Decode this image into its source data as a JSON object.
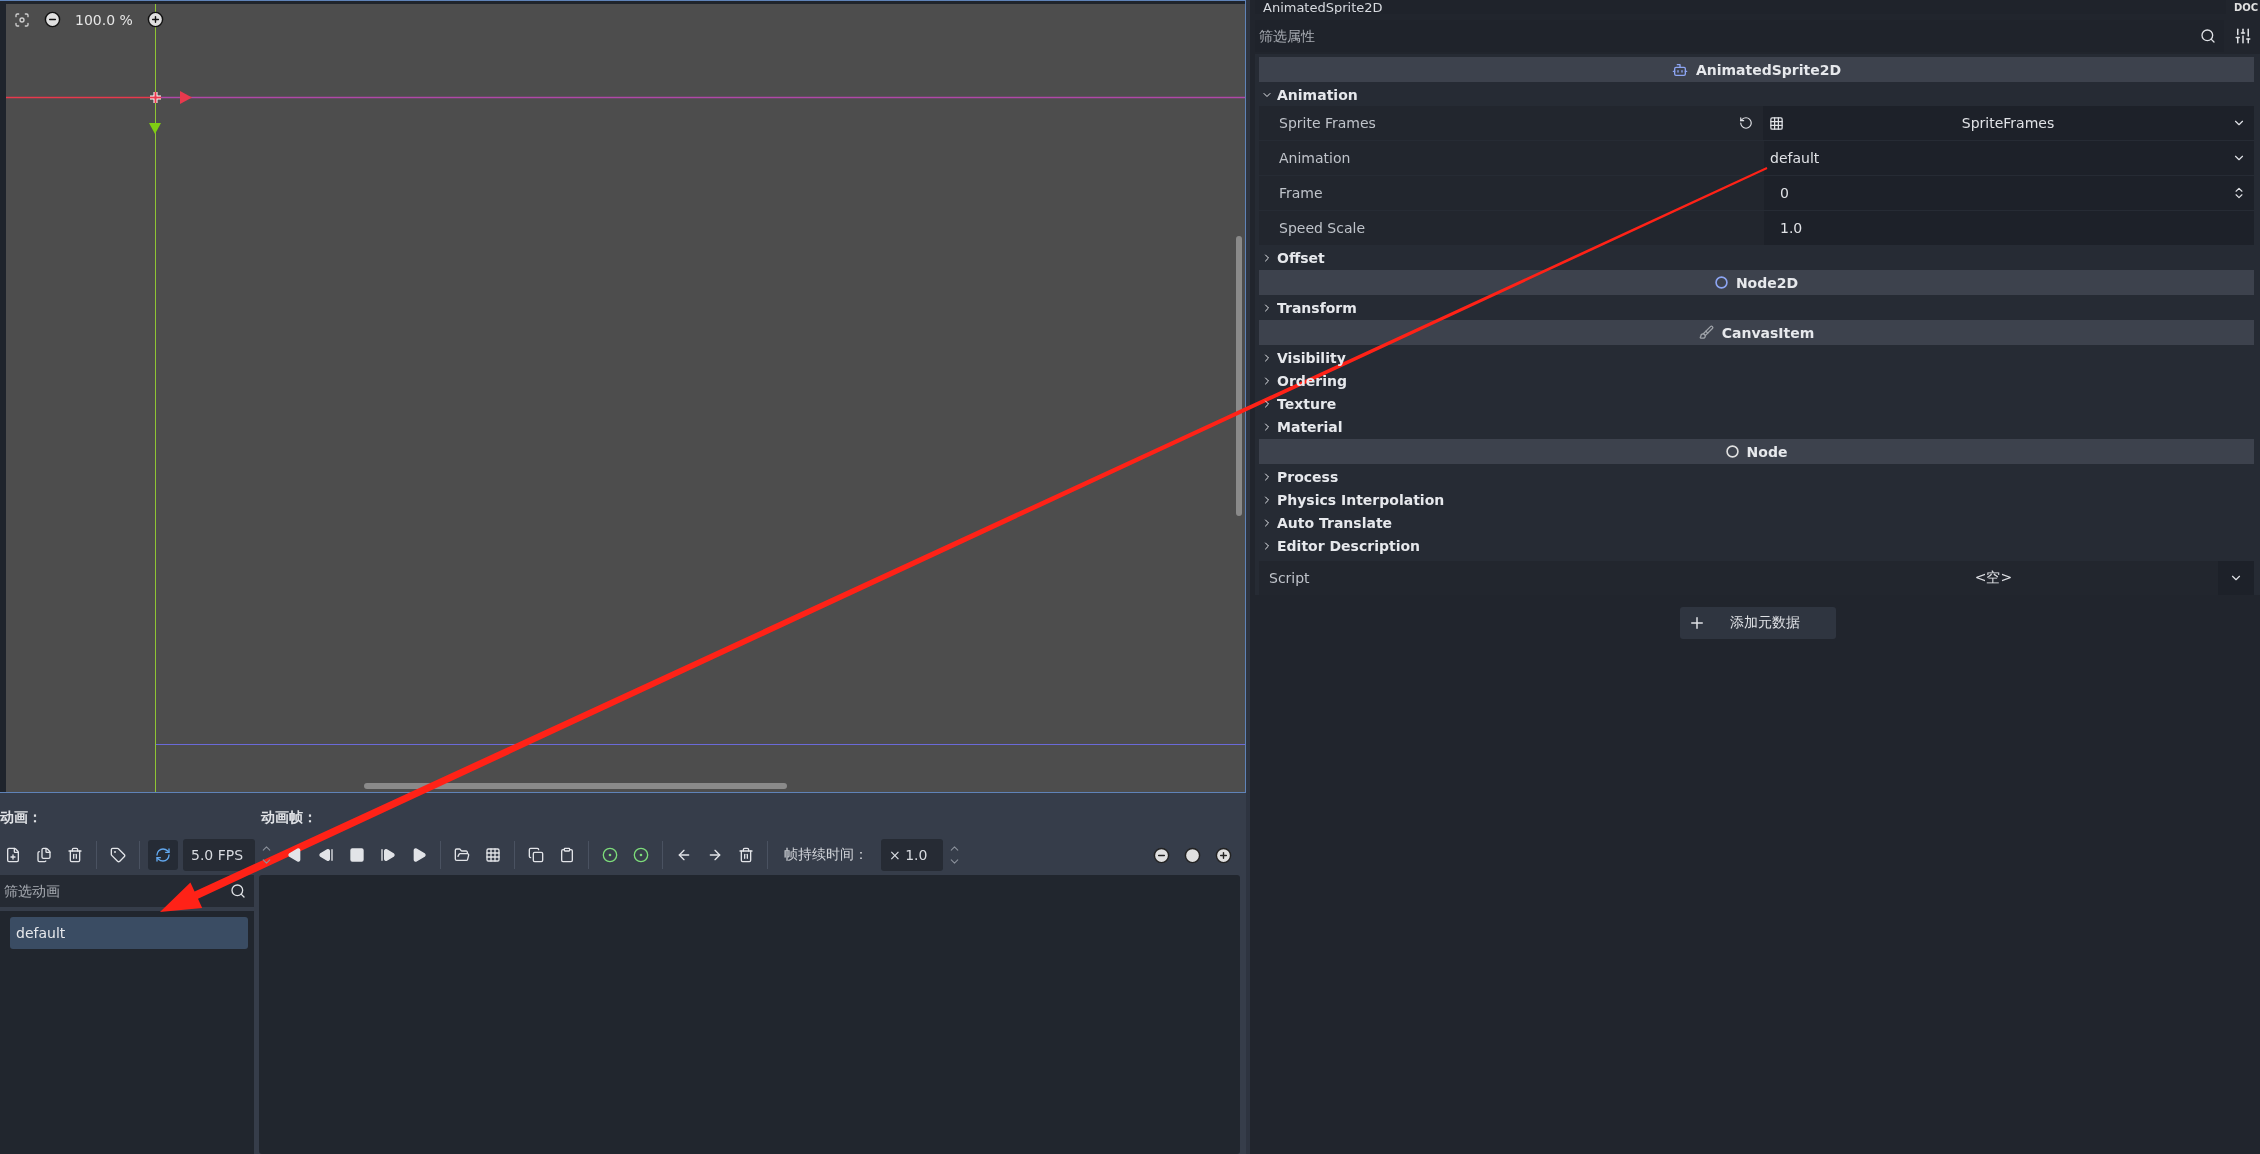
{
  "viewport": {
    "zoom": "100.0 %"
  },
  "animations": {
    "title": "动画：",
    "fps": "5.0 FPS",
    "loop_on": true,
    "filter_placeholder": "筛选动画",
    "items": [
      {
        "label": "default",
        "selected": true
      }
    ]
  },
  "frames": {
    "title": "动画帧：",
    "duration_label": "帧持续时间：",
    "duration": "× 1.0"
  },
  "inspector": {
    "node_selector": "AnimatedSprite2D",
    "doc_label": "DOC",
    "filter_placeholder": "筛选属性",
    "items": [
      {
        "kind": "class",
        "label": "AnimatedSprite2D"
      },
      {
        "kind": "section",
        "label": "Animation",
        "expanded": true
      },
      {
        "kind": "resource",
        "label": "Sprite Frames",
        "value": "SpriteFrames"
      },
      {
        "kind": "dropdown",
        "label": "Animation",
        "value": "default"
      },
      {
        "kind": "spin",
        "label": "Frame",
        "value": "0"
      },
      {
        "kind": "number",
        "label": "Speed Scale",
        "value": "1.0"
      },
      {
        "kind": "section",
        "label": "Offset",
        "expanded": false
      },
      {
        "kind": "class",
        "label": "Node2D"
      },
      {
        "kind": "section",
        "label": "Transform",
        "expanded": false
      },
      {
        "kind": "class",
        "label": "CanvasItem"
      },
      {
        "kind": "section",
        "label": "Visibility",
        "expanded": false
      },
      {
        "kind": "section",
        "label": "Ordering",
        "expanded": false
      },
      {
        "kind": "section",
        "label": "Texture",
        "expanded": false
      },
      {
        "kind": "section",
        "label": "Material",
        "expanded": false
      },
      {
        "kind": "class",
        "label": "Node"
      },
      {
        "kind": "section",
        "label": "Process",
        "expanded": false
      },
      {
        "kind": "section",
        "label": "Physics Interpolation",
        "expanded": false
      },
      {
        "kind": "section",
        "label": "Auto Translate",
        "expanded": false
      },
      {
        "kind": "section",
        "label": "Editor Description",
        "expanded": false
      },
      {
        "kind": "script",
        "label": "Script",
        "value": "<空>"
      }
    ],
    "add_metadata": "添加元数据"
  }
}
